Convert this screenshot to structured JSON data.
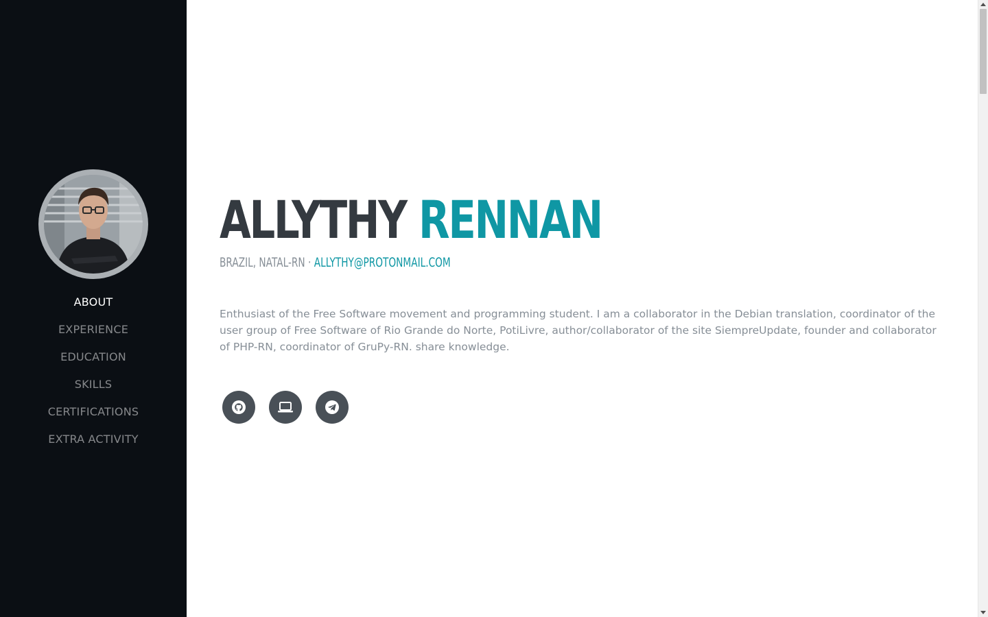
{
  "sidebar": {
    "nav": [
      {
        "label": "ABOUT",
        "active": true
      },
      {
        "label": "EXPERIENCE"
      },
      {
        "label": "EDUCATION"
      },
      {
        "label": "SKILLS"
      },
      {
        "label": "CERTIFICATIONS"
      },
      {
        "label": "EXTRA ACTIVITY"
      }
    ]
  },
  "about": {
    "first_name": "ALLYTHY",
    "last_name": "RENNAN",
    "location": "BRAZIL, NATAL-RN ·",
    "email": "ALLYTHY@PROTONMAIL.COM",
    "bio": "Enthusiast of the Free Software movement and programming student. I am a collaborator in the Debian translation, coordinator of the user group of Free Software of Rio Grande do Norte, PotiLivre, author/collaborator of the site SiempreUpdate, founder and collaborator of PHP-RN, coordinator of GruPy-RN. share knowledge."
  },
  "social": [
    {
      "icon": "github-icon"
    },
    {
      "icon": "laptop-icon"
    },
    {
      "icon": "telegram-icon"
    }
  ],
  "colors": {
    "sidebar_bg": "#0b0f14",
    "accent": "#0f97a4",
    "heading": "#343a40",
    "muted_text": "#868e96",
    "social_bg": "#495057"
  }
}
